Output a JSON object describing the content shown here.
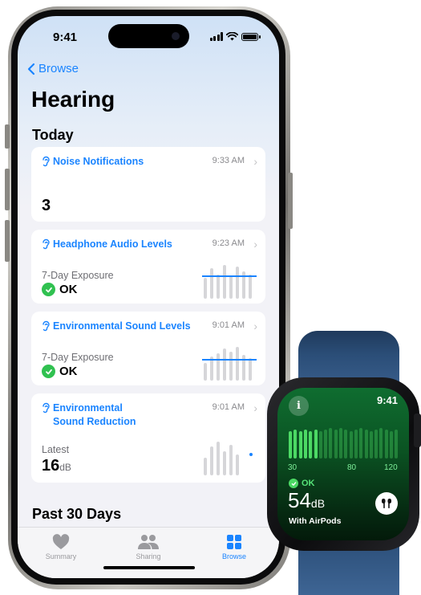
{
  "status_bar": {
    "time": "9:41"
  },
  "nav": {
    "back_label": "Browse"
  },
  "page": {
    "title": "Hearing"
  },
  "sections": {
    "today": "Today",
    "past": "Past 30 Days"
  },
  "cards": [
    {
      "title": "Noise Notifications",
      "time": "9:33 AM",
      "value": "3"
    },
    {
      "title": "Headphone Audio Levels",
      "time": "9:23 AM",
      "label": "7-Day Exposure",
      "status": "OK"
    },
    {
      "title": "Environmental Sound Levels",
      "time": "9:01 AM",
      "label": "7-Day Exposure",
      "status": "OK"
    },
    {
      "title_line1": "Environmental",
      "title_line2": "Sound Reduction",
      "time": "9:01 AM",
      "label": "Latest",
      "value": "16",
      "unit": "dB"
    }
  ],
  "tabs": [
    {
      "label": "Summary",
      "icon": "heart-icon"
    },
    {
      "label": "Sharing",
      "icon": "people-icon"
    },
    {
      "label": "Browse",
      "icon": "grid-icon",
      "active": true
    }
  ],
  "watch": {
    "time": "9:41",
    "scale": [
      "30",
      "80",
      "120"
    ],
    "status": "OK",
    "value": "54",
    "unit": "dB",
    "caption": "With AirPods",
    "icons": [
      "info-icon",
      "airpods-icon"
    ]
  },
  "colors": {
    "accent": "#1a84ff",
    "ok_green": "#30c150",
    "watch_green": "#4cd964"
  }
}
